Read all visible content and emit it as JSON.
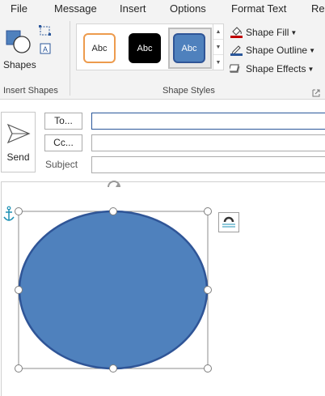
{
  "menu": {
    "tabs": [
      "File",
      "Message",
      "Insert",
      "Options",
      "Format Text",
      "Re"
    ]
  },
  "ribbon": {
    "insert_shapes": {
      "shapes_label": "Shapes",
      "group_label": "Insert Shapes"
    },
    "shape_styles": {
      "group_label": "Shape Styles",
      "swatches": [
        {
          "text": "Abc",
          "style": "white fill, orange outline"
        },
        {
          "text": "Abc",
          "style": "black fill"
        },
        {
          "text": "Abc",
          "style": "blue fill",
          "selected": true
        }
      ],
      "fill_label": "Shape Fill",
      "outline_label": "Shape Outline",
      "effects_label": "Shape Effects"
    }
  },
  "compose": {
    "send_label": "Send",
    "to_label": "To...",
    "cc_label": "Cc...",
    "subject_label": "Subject",
    "to_value": "",
    "cc_value": "",
    "subject_value": ""
  },
  "colors": {
    "ellipse_fill": "#4f81bd",
    "ellipse_stroke": "#2f5597",
    "accent": "#2b579a",
    "anchor": "#1e90b4"
  },
  "icons": [
    "edit-shape-icon",
    "text-box-icon",
    "paint-bucket-icon",
    "pen-icon",
    "effects-icon",
    "send-icon",
    "rotate-handle-icon",
    "anchor-icon",
    "layout-options-icon"
  ]
}
